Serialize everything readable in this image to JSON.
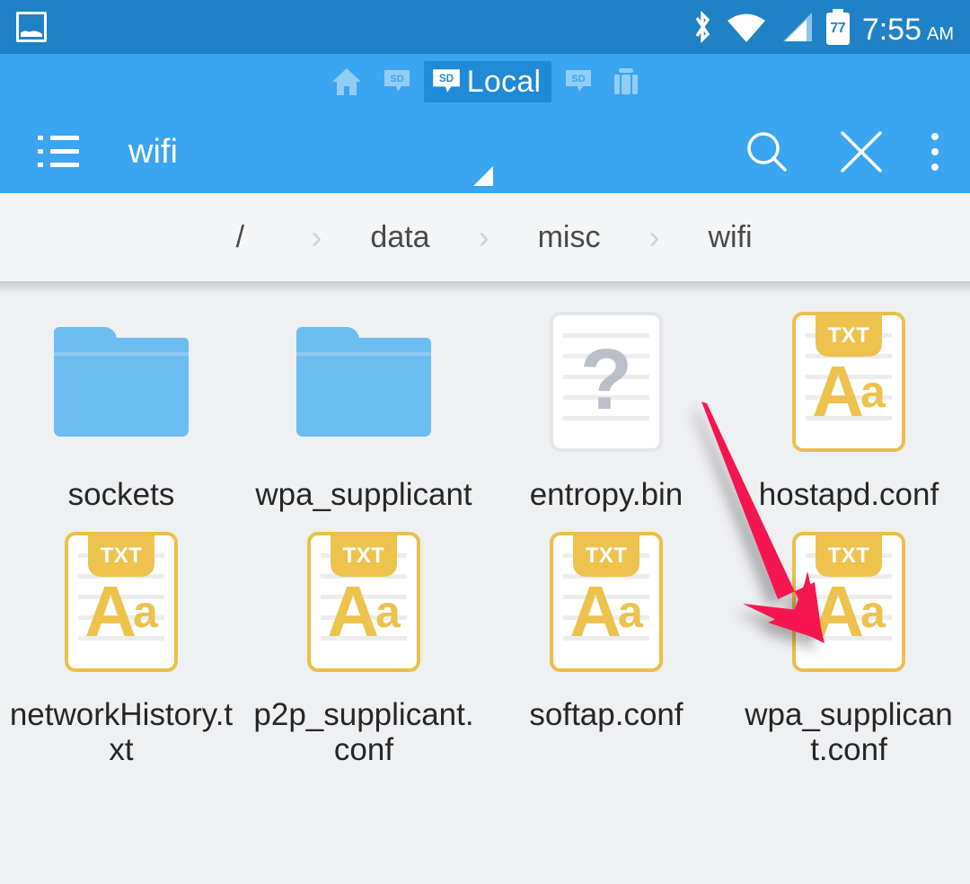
{
  "status_bar": {
    "notification_icon": "gallery-icon",
    "icons": [
      "bluetooth-icon",
      "wifi-icon",
      "cell-signal-icon"
    ],
    "battery_level": "77",
    "time": "7:55",
    "ampm": "AM",
    "background_color": "#1f82c4"
  },
  "app_bar": {
    "background_color": "#3aa5f0",
    "tabs": [
      {
        "icon": "home-icon",
        "label": "",
        "selected": false
      },
      {
        "icon": "sd-card-icon",
        "label": "",
        "selected": false
      },
      {
        "icon": "sd-card-icon",
        "label": "Local",
        "selected": true
      },
      {
        "icon": "sd-card-icon",
        "label": "",
        "selected": false
      },
      {
        "icon": "android-usb-icon",
        "label": "",
        "selected": false
      }
    ],
    "menu_icon": "list-menu-icon",
    "title": "wifi",
    "actions": [
      {
        "name": "search-icon",
        "label": "Search"
      },
      {
        "name": "close-icon",
        "label": "Close"
      },
      {
        "name": "overflow-menu-icon",
        "label": "More options"
      }
    ]
  },
  "breadcrumb": {
    "separator": "›",
    "items": [
      "/",
      "data",
      "misc",
      "wifi"
    ]
  },
  "files": [
    {
      "name": "sockets",
      "type": "folder",
      "badge": ""
    },
    {
      "name": "wpa_supplicant",
      "type": "folder",
      "badge": ""
    },
    {
      "name": "entropy.bin",
      "type": "unknown",
      "badge": "?"
    },
    {
      "name": "hostapd.conf",
      "type": "text",
      "badge": "TXT"
    },
    {
      "name": "networkHistory.txt",
      "type": "text",
      "badge": "TXT"
    },
    {
      "name": "p2p_supplicant.conf",
      "type": "text",
      "badge": "TXT"
    },
    {
      "name": "softap.conf",
      "type": "text",
      "badge": "TXT"
    },
    {
      "name": "wpa_supplicant.conf",
      "type": "text",
      "badge": "TXT"
    }
  ],
  "annotation": {
    "type": "arrow",
    "color": "#f5154f",
    "points_to": "wpa_supplicant.conf"
  },
  "colors": {
    "status_bar": "#1f82c4",
    "app_bar": "#3aa5f0",
    "tab_selected": "#1f8ad6",
    "page_background": "#eff0f2",
    "breadcrumb_background": "#f4f5f7",
    "folder": "#6cbdf2",
    "txt_accent": "#edc24d",
    "unknown_accent": "#b9c0cb",
    "arrow": "#f5154f",
    "label_text": "#262626"
  }
}
